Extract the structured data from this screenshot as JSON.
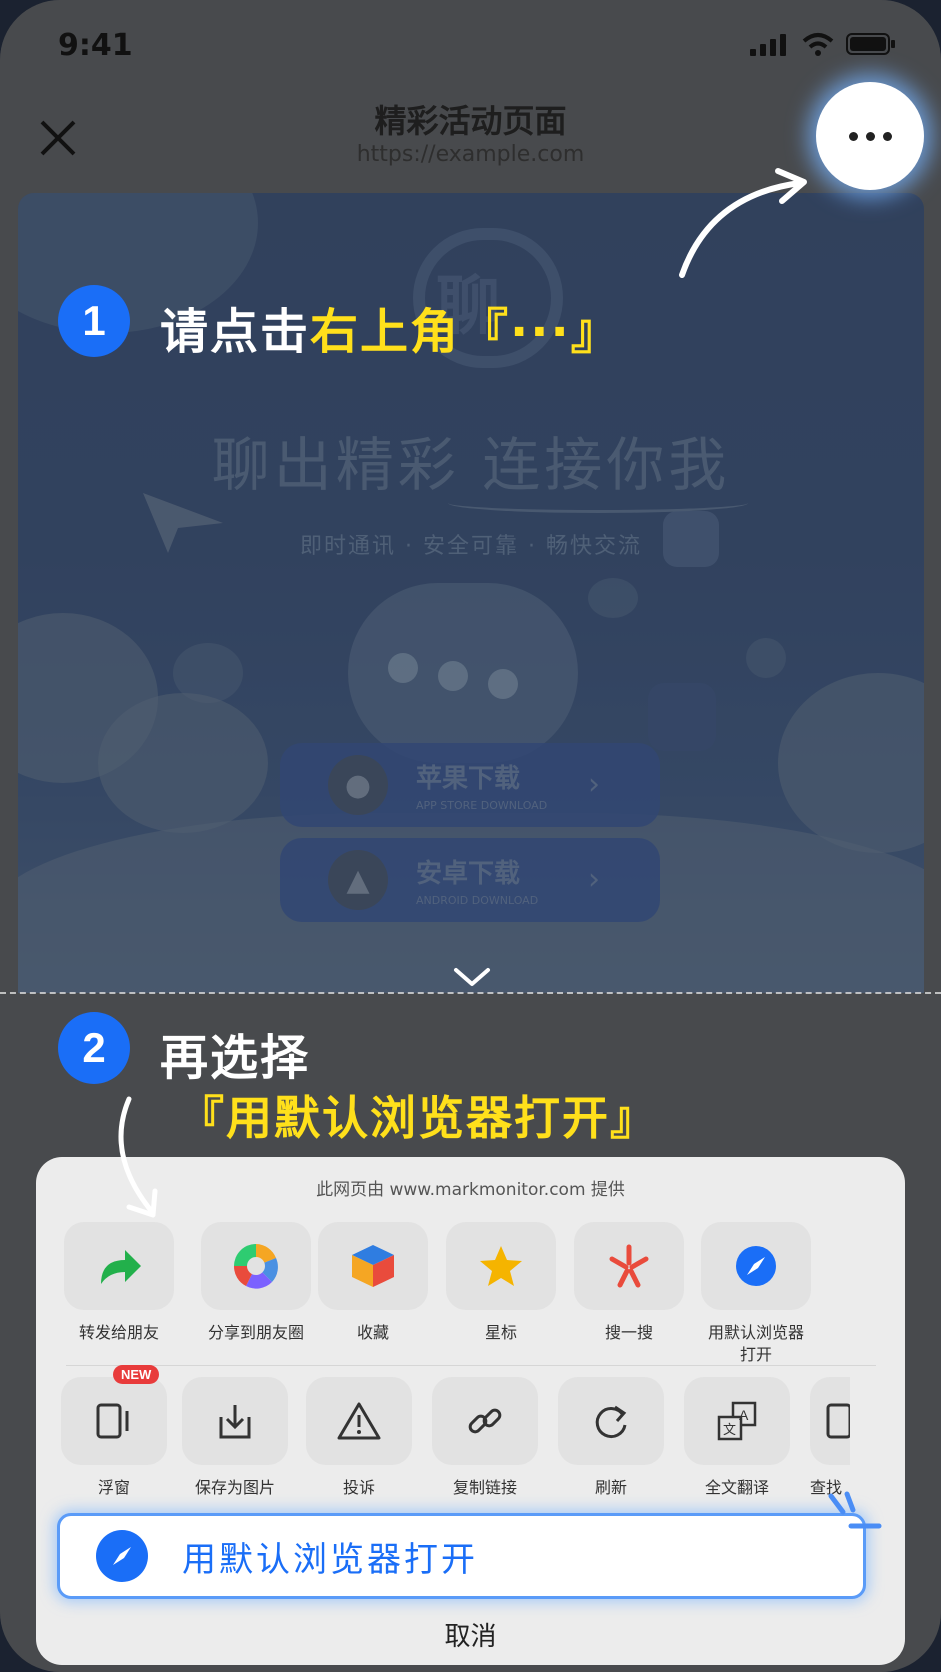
{
  "status_bar": {
    "time": "9:41"
  },
  "header": {
    "title": "精彩活动页面",
    "url": "https://example.com"
  },
  "web_content": {
    "logo_text": "聊",
    "slogan": "聊出精彩 连接你我",
    "subtitle": "即时通讯 · 安全可靠 · 畅快交流",
    "download_buttons": [
      {
        "label": "苹果下载",
        "sub": "APP STORE DOWNLOAD",
        "icon": "apple-icon"
      },
      {
        "label": "安卓下载",
        "sub": "ANDROID DOWNLOAD",
        "icon": "android-icon"
      }
    ]
  },
  "instructions": {
    "step1": {
      "number": "1",
      "prefix": "请点击",
      "highlight": "右上角『···』"
    },
    "step2": {
      "number": "2",
      "line1": "再选择",
      "line2": "『用默认浏览器打开』"
    }
  },
  "sheet": {
    "provider": "此网页由 www.markmonitor.com 提供",
    "row1": [
      {
        "label": "转发给朋友",
        "icon": "forward-icon"
      },
      {
        "label": "分享到朋友圈",
        "icon": "moments-icon"
      },
      {
        "label": "收藏",
        "icon": "favorite-cube-icon"
      },
      {
        "label": "星标",
        "icon": "star-icon"
      },
      {
        "label": "搜一搜",
        "icon": "search-one-icon"
      },
      {
        "label": "用默认浏览器\n打开",
        "icon": "compass-icon"
      }
    ],
    "row2": [
      {
        "label": "浮窗",
        "icon": "float-window-icon",
        "badge": "NEW"
      },
      {
        "label": "保存为图片",
        "icon": "save-image-icon"
      },
      {
        "label": "投诉",
        "icon": "warning-icon"
      },
      {
        "label": "复制链接",
        "icon": "link-icon"
      },
      {
        "label": "刷新",
        "icon": "refresh-icon"
      },
      {
        "label": "全文翻译",
        "icon": "translate-icon"
      },
      {
        "label": "查找",
        "icon": "find-icon"
      }
    ],
    "open_browser_label": "用默认浏览器打开",
    "cancel_label": "取消"
  },
  "colors": {
    "accent_blue": "#1a6ef7",
    "highlight_yellow": "#ffe01b",
    "badge_red": "#e83b3b"
  }
}
